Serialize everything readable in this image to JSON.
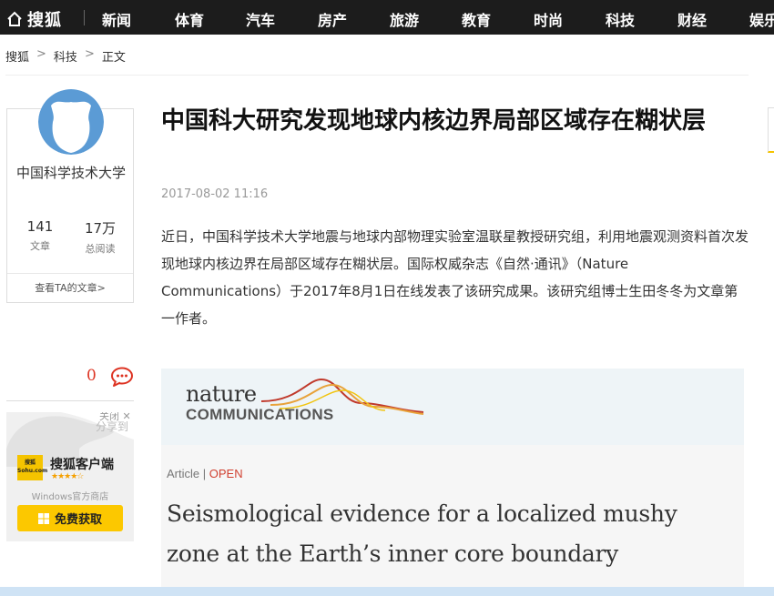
{
  "brand": {
    "name": "搜狐"
  },
  "nav": {
    "items": [
      "新闻",
      "体育",
      "汽车",
      "房产",
      "旅游",
      "教育",
      "时尚",
      "科技",
      "财经",
      "娱乐"
    ]
  },
  "breadcrumb": [
    "搜狐",
    "科技",
    "正文"
  ],
  "author": {
    "name": "中国科学技术大学",
    "articles_count": "141",
    "articles_label": "文章",
    "reads_count": "17万",
    "reads_label": "总阅读",
    "view_link": "查看TA的文章>"
  },
  "comments": {
    "count": "0"
  },
  "promo": {
    "close_label": "关闭",
    "share_label": "分享到",
    "logo_text": "搜狐 Sohu.com",
    "title": "搜狐客户端",
    "rating": 4.5,
    "store": "Windows官方商店",
    "cta": "免费获取"
  },
  "article": {
    "title": "中国科大研究发现地球内核边界局部区域存在糊状层",
    "time": "2017-08-02 11:16",
    "body": "近日，中国科学技术大学地震与地球内部物理实验室温联星教授研究组，利用地震观测资料首次发现地球内核边界在局部区域存在糊状层。国际权威杂志《自然·通讯》（Nature Communications）于2017年8月1日在线发表了该研究成果。该研究组博士生田冬冬为文章第一作者。"
  },
  "figure": {
    "journal_line1": "nature",
    "journal_line2": "COMMUNICATIONS",
    "kind": "Article",
    "access": "OPEN",
    "headline": "Seismological evidence for a localized mushy zone at the Earth’s inner core boundary"
  },
  "colors": {
    "nav_bg": "#1c1c1c",
    "accent_yellow": "#fcc800",
    "comment_red": "#dd3322",
    "avatar_blue": "#5b9bd5"
  }
}
